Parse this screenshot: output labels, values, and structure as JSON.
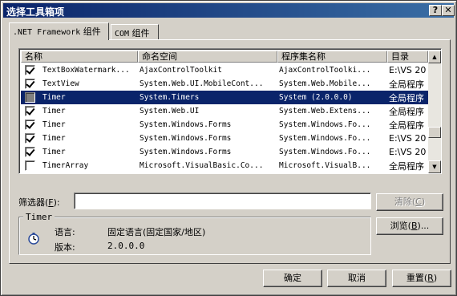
{
  "window": {
    "title": "选择工具箱项",
    "help_glyph": "?",
    "close_glyph": "✕"
  },
  "tabs": [
    {
      "prefix": ".NET Framework",
      "label": " 组件"
    },
    {
      "prefix": "COM",
      "label": " 组件"
    }
  ],
  "columns": [
    "名称",
    "命名空间",
    "程序集名称",
    "目录"
  ],
  "rows": [
    {
      "checked": true,
      "name": "TextBoxWatermark...",
      "namespace": "AjaxControlToolkit",
      "assembly": "AjaxControlToolki...",
      "dir": "E:\\VS 20"
    },
    {
      "checked": true,
      "name": "TextView",
      "namespace": "System.Web.UI.MobileCont...",
      "assembly": "System.Web.Mobile...",
      "dir": "全局程序"
    },
    {
      "checked": false,
      "name": "Timer",
      "namespace": "System.Timers",
      "assembly": "System (2.0.0.0)",
      "dir": "全局程序",
      "selected": true
    },
    {
      "checked": true,
      "name": "Timer",
      "namespace": "System.Web.UI",
      "assembly": "System.Web.Extens...",
      "dir": "全局程序"
    },
    {
      "checked": true,
      "name": "Timer",
      "namespace": "System.Windows.Forms",
      "assembly": "System.Windows.Fo...",
      "dir": "全局程序"
    },
    {
      "checked": true,
      "name": "Timer",
      "namespace": "System.Windows.Forms",
      "assembly": "System.Windows.Fo...",
      "dir": "E:\\VS 20"
    },
    {
      "checked": true,
      "name": "Timer",
      "namespace": "System.Windows.Forms",
      "assembly": "System.Windows.Fo...",
      "dir": "E:\\VS 20"
    },
    {
      "checked": false,
      "name": "TimerArray",
      "namespace": "Microsoft.VisualBasic.Co...",
      "assembly": "Microsoft.VisualB...",
      "dir": "全局程序"
    }
  ],
  "scroll": {
    "up_glyph": "▲",
    "down_glyph": "▼"
  },
  "filter": {
    "label": "筛选器",
    "accel": "F",
    "value": ""
  },
  "buttons": {
    "clear": "清除",
    "clear_accel": "C",
    "browse": "浏览",
    "browse_accel": "B",
    "browse_suffix": "...",
    "ok": "确定",
    "cancel": "取消",
    "reset": "重置",
    "reset_accel": "R"
  },
  "details": {
    "group_title": "Timer",
    "language_label": "语言:",
    "language_value": "固定语言(固定国家/地区)",
    "version_label": "版本:",
    "version_value": "2.0.0.0"
  }
}
